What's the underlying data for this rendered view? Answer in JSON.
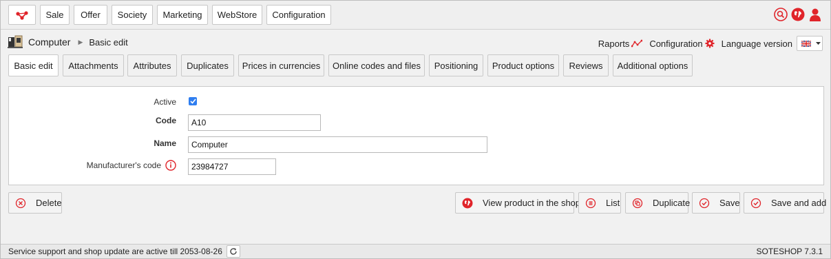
{
  "nav": {
    "items": [
      {
        "label": "Sale"
      },
      {
        "label": "Offer"
      },
      {
        "label": "Society"
      },
      {
        "label": "Marketing"
      },
      {
        "label": "WebStore"
      },
      {
        "label": "Configuration"
      }
    ]
  },
  "header": {
    "product_name": "Computer",
    "breadcrumb_current": "Basic edit",
    "raports_label": "Raports",
    "configuration_label": "Configuration",
    "language_label": "Language version"
  },
  "tabs": [
    {
      "label": "Basic edit",
      "active": true
    },
    {
      "label": "Attachments"
    },
    {
      "label": "Attributes"
    },
    {
      "label": "Duplicates"
    },
    {
      "label": "Prices in currencies"
    },
    {
      "label": "Online codes and files"
    },
    {
      "label": "Positioning"
    },
    {
      "label": "Product options"
    },
    {
      "label": "Reviews"
    },
    {
      "label": "Additional options"
    }
  ],
  "form": {
    "active_label": "Active",
    "active_checked": true,
    "code_label": "Code",
    "code_value": "A10",
    "name_label": "Name",
    "name_value": "Computer",
    "manufacturer_label": "Manufacturer's code",
    "manufacturer_value": "23984727"
  },
  "actions": {
    "delete": "Delete",
    "view": "View product in the shop",
    "list": "List",
    "duplicate": "Duplicate",
    "save": "Save",
    "save_add": "Save and add"
  },
  "footer": {
    "status": "Service support and shop update are active till 2053-08-26",
    "version": "SOTESHOP 7.3.1"
  },
  "colors": {
    "accent": "#e0242a",
    "checkbox": "#2f7ef0"
  }
}
